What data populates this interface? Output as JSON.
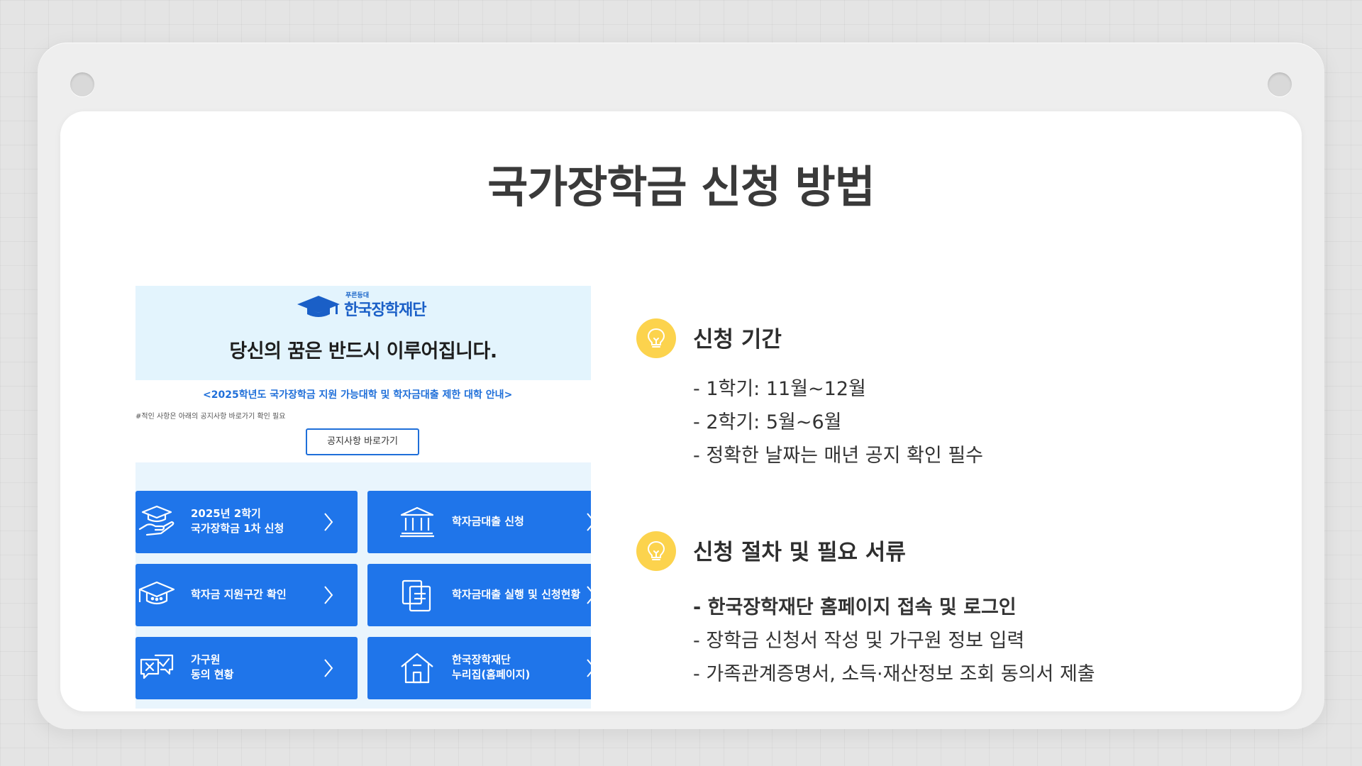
{
  "slide": {
    "title": "국가장학금 신청 방법"
  },
  "embedded": {
    "logo_tag": "푸른등대",
    "logo_name": "한국장학재단",
    "headline": "당신의 꿈은 반드시 이루어집니다.",
    "notice_link": "<2025학년도 국가장학금 지원 가능대학 및 학자금대출 제한 대학 안내>",
    "notice_sub": "#적인 사항은 아래의 공지사항 바로가기 확인 필요",
    "notice_button": "공지사항 바로가기",
    "tiles": [
      {
        "label": "2025년 2학기\n국가장학금 1차 신청",
        "icon": "graduation-hand-icon"
      },
      {
        "label": "학자금대출 신청",
        "icon": "bank-icon"
      },
      {
        "label": "학자금 지원구간 확인",
        "icon": "graduation-cap-icon"
      },
      {
        "label": "학자금대출 실행 및 신청현황",
        "icon": "documents-icon"
      },
      {
        "label": "가구원\n동의 현황",
        "icon": "consent-chat-icon"
      },
      {
        "label": "한국장학재단\n누리집(홈페이지)",
        "icon": "home-icon"
      }
    ]
  },
  "sections": [
    {
      "icon": "lightbulb-icon",
      "title": "신청 기간",
      "items": [
        "- 1학기: 11월~12월",
        "- 2학기: 5월~6월",
        "- 정확한 날짜는 매년 공지 확인 필수"
      ]
    },
    {
      "icon": "lightbulb-icon",
      "title": "신청 절차 및 필요 서류",
      "items": [
        "- 한국장학재단 홈페이지 접속 및 로그인",
        "- 장학금 신청서 작성 및 가구원 정보 입력",
        "- 가족관계증명서, 소득·재산정보 조회 동의서 제출"
      ]
    }
  ],
  "colors": {
    "accent_yellow": "#fcd34d",
    "tile_blue": "#1f75ea",
    "brand_blue": "#1a5fc7"
  }
}
